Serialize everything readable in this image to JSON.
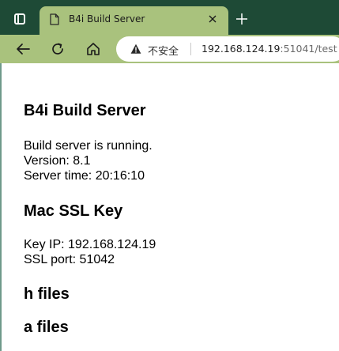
{
  "browser": {
    "tab": {
      "title": "B4i Build Server"
    },
    "omnibox": {
      "security_label": "不安全",
      "url_host": "192.168.124.19",
      "url_rest": ":51041/test"
    },
    "colors": {
      "tab_strip": "#1e4a36",
      "toolbar": "#a9c27d"
    },
    "icons": {
      "tab_actions": "tab-actions-icon",
      "page": "page-icon",
      "close": "close-icon",
      "new_tab": "plus-icon",
      "back": "back-arrow-icon",
      "reload": "reload-icon",
      "home": "home-icon",
      "warning": "warning-triangle-icon"
    }
  },
  "page": {
    "title": "B4i Build Server",
    "status_line": "Build server is running.",
    "version_line": "Version: 8.1",
    "server_time_line": "Server time: 20:16:10",
    "ssl_heading": "Mac SSL Key",
    "key_ip_line": "Key IP: 192.168.124.19",
    "ssl_port_line": "SSL port: 51042",
    "h_files_heading": "h files",
    "a_files_heading": "a files"
  }
}
